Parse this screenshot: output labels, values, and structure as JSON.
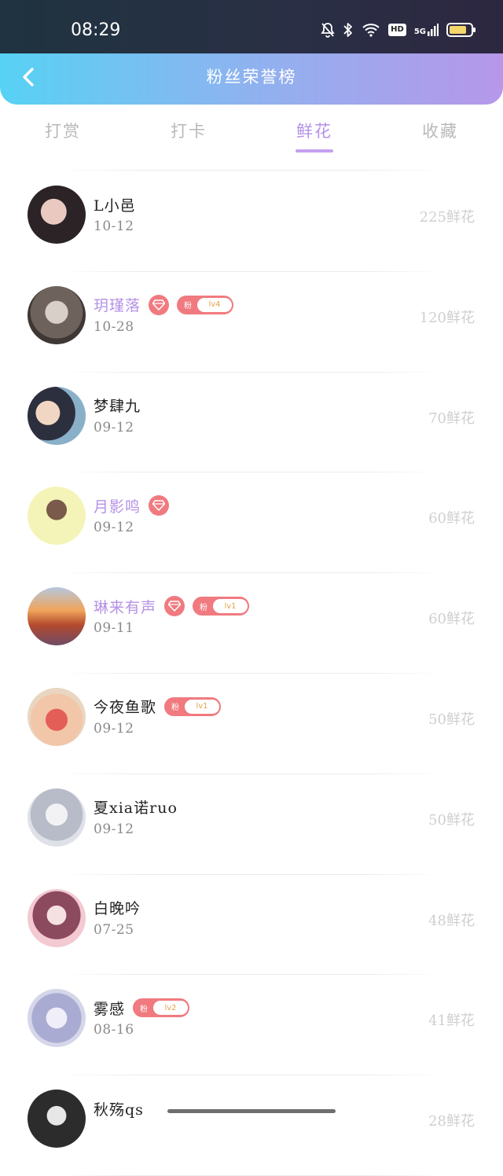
{
  "status_bar": {
    "time": "08:29",
    "icons": [
      "mute-icon",
      "bluetooth-icon",
      "wifi-icon",
      "hd-icon",
      "signal-5g-icon",
      "battery-icon"
    ],
    "hd_label": "HD",
    "network_label": "5G",
    "battery_level": 0.8
  },
  "header": {
    "title": "粉丝荣誉榜",
    "back_icon": "chevron-left-icon"
  },
  "tabs": [
    {
      "label": "打赏",
      "active": false
    },
    {
      "label": "打卡",
      "active": false
    },
    {
      "label": "鲜花",
      "active": true
    },
    {
      "label": "收藏",
      "active": false
    }
  ],
  "badges": {
    "fan_label": "粉"
  },
  "fans": [
    {
      "name": "L小邑",
      "date": "10-12",
      "amount": "225鲜花",
      "vip": false,
      "diamond": false,
      "level": null
    },
    {
      "name": "玥瑾落",
      "date": "10-28",
      "amount": "120鲜花",
      "vip": true,
      "diamond": true,
      "level": "lv4"
    },
    {
      "name": "梦肆九",
      "date": "09-12",
      "amount": "70鲜花",
      "vip": false,
      "diamond": false,
      "level": null
    },
    {
      "name": "月影鸣",
      "date": "09-12",
      "amount": "60鲜花",
      "vip": true,
      "diamond": true,
      "level": null
    },
    {
      "name": "琳来有声",
      "date": "09-11",
      "amount": "60鲜花",
      "vip": true,
      "diamond": true,
      "level": "lv1"
    },
    {
      "name": "今夜鱼歌",
      "date": "09-12",
      "amount": "50鲜花",
      "vip": false,
      "diamond": false,
      "level": "lv1"
    },
    {
      "name": "夏xia诺ruo",
      "date": "09-12",
      "amount": "50鲜花",
      "vip": false,
      "diamond": false,
      "level": null
    },
    {
      "name": "白晚吟",
      "date": "07-25",
      "amount": "48鲜花",
      "vip": false,
      "diamond": false,
      "level": null
    },
    {
      "name": "雾感",
      "date": "08-16",
      "amount": "41鲜花",
      "vip": false,
      "diamond": false,
      "level": "lv2"
    },
    {
      "name": "秋殇qs",
      "date": "",
      "amount": "28鲜花",
      "vip": false,
      "diamond": false,
      "level": null
    }
  ],
  "colors": {
    "accent": "#b591e6",
    "badge": "#f07a7f",
    "header_start": "#57d2f4",
    "header_end": "#b697ea"
  }
}
